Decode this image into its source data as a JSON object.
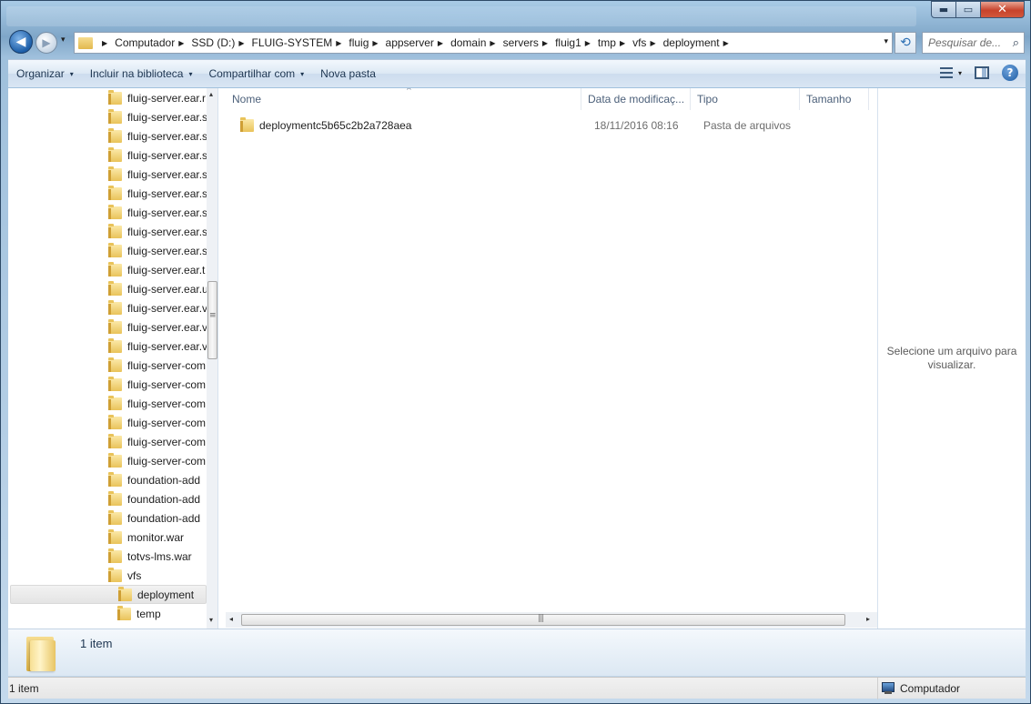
{
  "window": {
    "minimize": "▬",
    "maximize": "▭",
    "close": "✕"
  },
  "nav": {
    "back": "◀",
    "forward": "▶",
    "history_dropdown": "▾",
    "breadcrumb": [
      "Computador",
      "SSD (D:)",
      "FLUIG-SYSTEM",
      "fluig",
      "appserver",
      "domain",
      "servers",
      "fluig1",
      "tmp",
      "vfs",
      "deployment"
    ],
    "address_dropdown": "▾",
    "refresh": "⟲",
    "search_placeholder": "Pesquisar de...",
    "search_icon": "⌕"
  },
  "toolbar": {
    "organize": "Organizar",
    "include_library": "Incluir na biblioteca",
    "share_with": "Compartilhar com",
    "new_folder": "Nova pasta",
    "dropdown_glyph": "▾",
    "help": "?"
  },
  "navpane": {
    "items": [
      {
        "label": "fluig-server.ear.r",
        "indent": 1
      },
      {
        "label": "fluig-server.ear.s",
        "indent": 1
      },
      {
        "label": "fluig-server.ear.s",
        "indent": 1
      },
      {
        "label": "fluig-server.ear.s",
        "indent": 1
      },
      {
        "label": "fluig-server.ear.s",
        "indent": 1
      },
      {
        "label": "fluig-server.ear.s",
        "indent": 1
      },
      {
        "label": "fluig-server.ear.s",
        "indent": 1
      },
      {
        "label": "fluig-server.ear.s",
        "indent": 1
      },
      {
        "label": "fluig-server.ear.s",
        "indent": 1
      },
      {
        "label": "fluig-server.ear.t",
        "indent": 1
      },
      {
        "label": "fluig-server.ear.u",
        "indent": 1
      },
      {
        "label": "fluig-server.ear.v",
        "indent": 1
      },
      {
        "label": "fluig-server.ear.v",
        "indent": 1
      },
      {
        "label": "fluig-server.ear.v",
        "indent": 1
      },
      {
        "label": "fluig-server-com",
        "indent": 1
      },
      {
        "label": "fluig-server-com",
        "indent": 1
      },
      {
        "label": "fluig-server-com",
        "indent": 1
      },
      {
        "label": "fluig-server-com",
        "indent": 1
      },
      {
        "label": "fluig-server-com",
        "indent": 1
      },
      {
        "label": "fluig-server-com",
        "indent": 1
      },
      {
        "label": "foundation-add",
        "indent": 1
      },
      {
        "label": "foundation-add",
        "indent": 1
      },
      {
        "label": "foundation-add",
        "indent": 1
      },
      {
        "label": "monitor.war",
        "indent": 1
      },
      {
        "label": "totvs-lms.war",
        "indent": 1
      },
      {
        "label": "vfs",
        "indent": 1
      },
      {
        "label": "deployment",
        "indent": 2,
        "selected": true
      },
      {
        "label": "temp",
        "indent": 2
      }
    ],
    "scroll_up": "▴",
    "scroll_down": "▾"
  },
  "columns": {
    "name": "Nome",
    "date": "Data de modificaç...",
    "type": "Tipo",
    "size": "Tamanho",
    "sort_indicator": "^"
  },
  "files": [
    {
      "name": "deploymentc5b65c2b2a728aea",
      "date": "18/11/2016 08:16",
      "type": "Pasta de arquivos",
      "size": ""
    }
  ],
  "hscroll": {
    "left": "◂",
    "right": "▸"
  },
  "preview": {
    "message": "Selecione um arquivo para visualizar."
  },
  "details": {
    "count": "1 item"
  },
  "status": {
    "left": "1 item",
    "right": "Computador"
  }
}
